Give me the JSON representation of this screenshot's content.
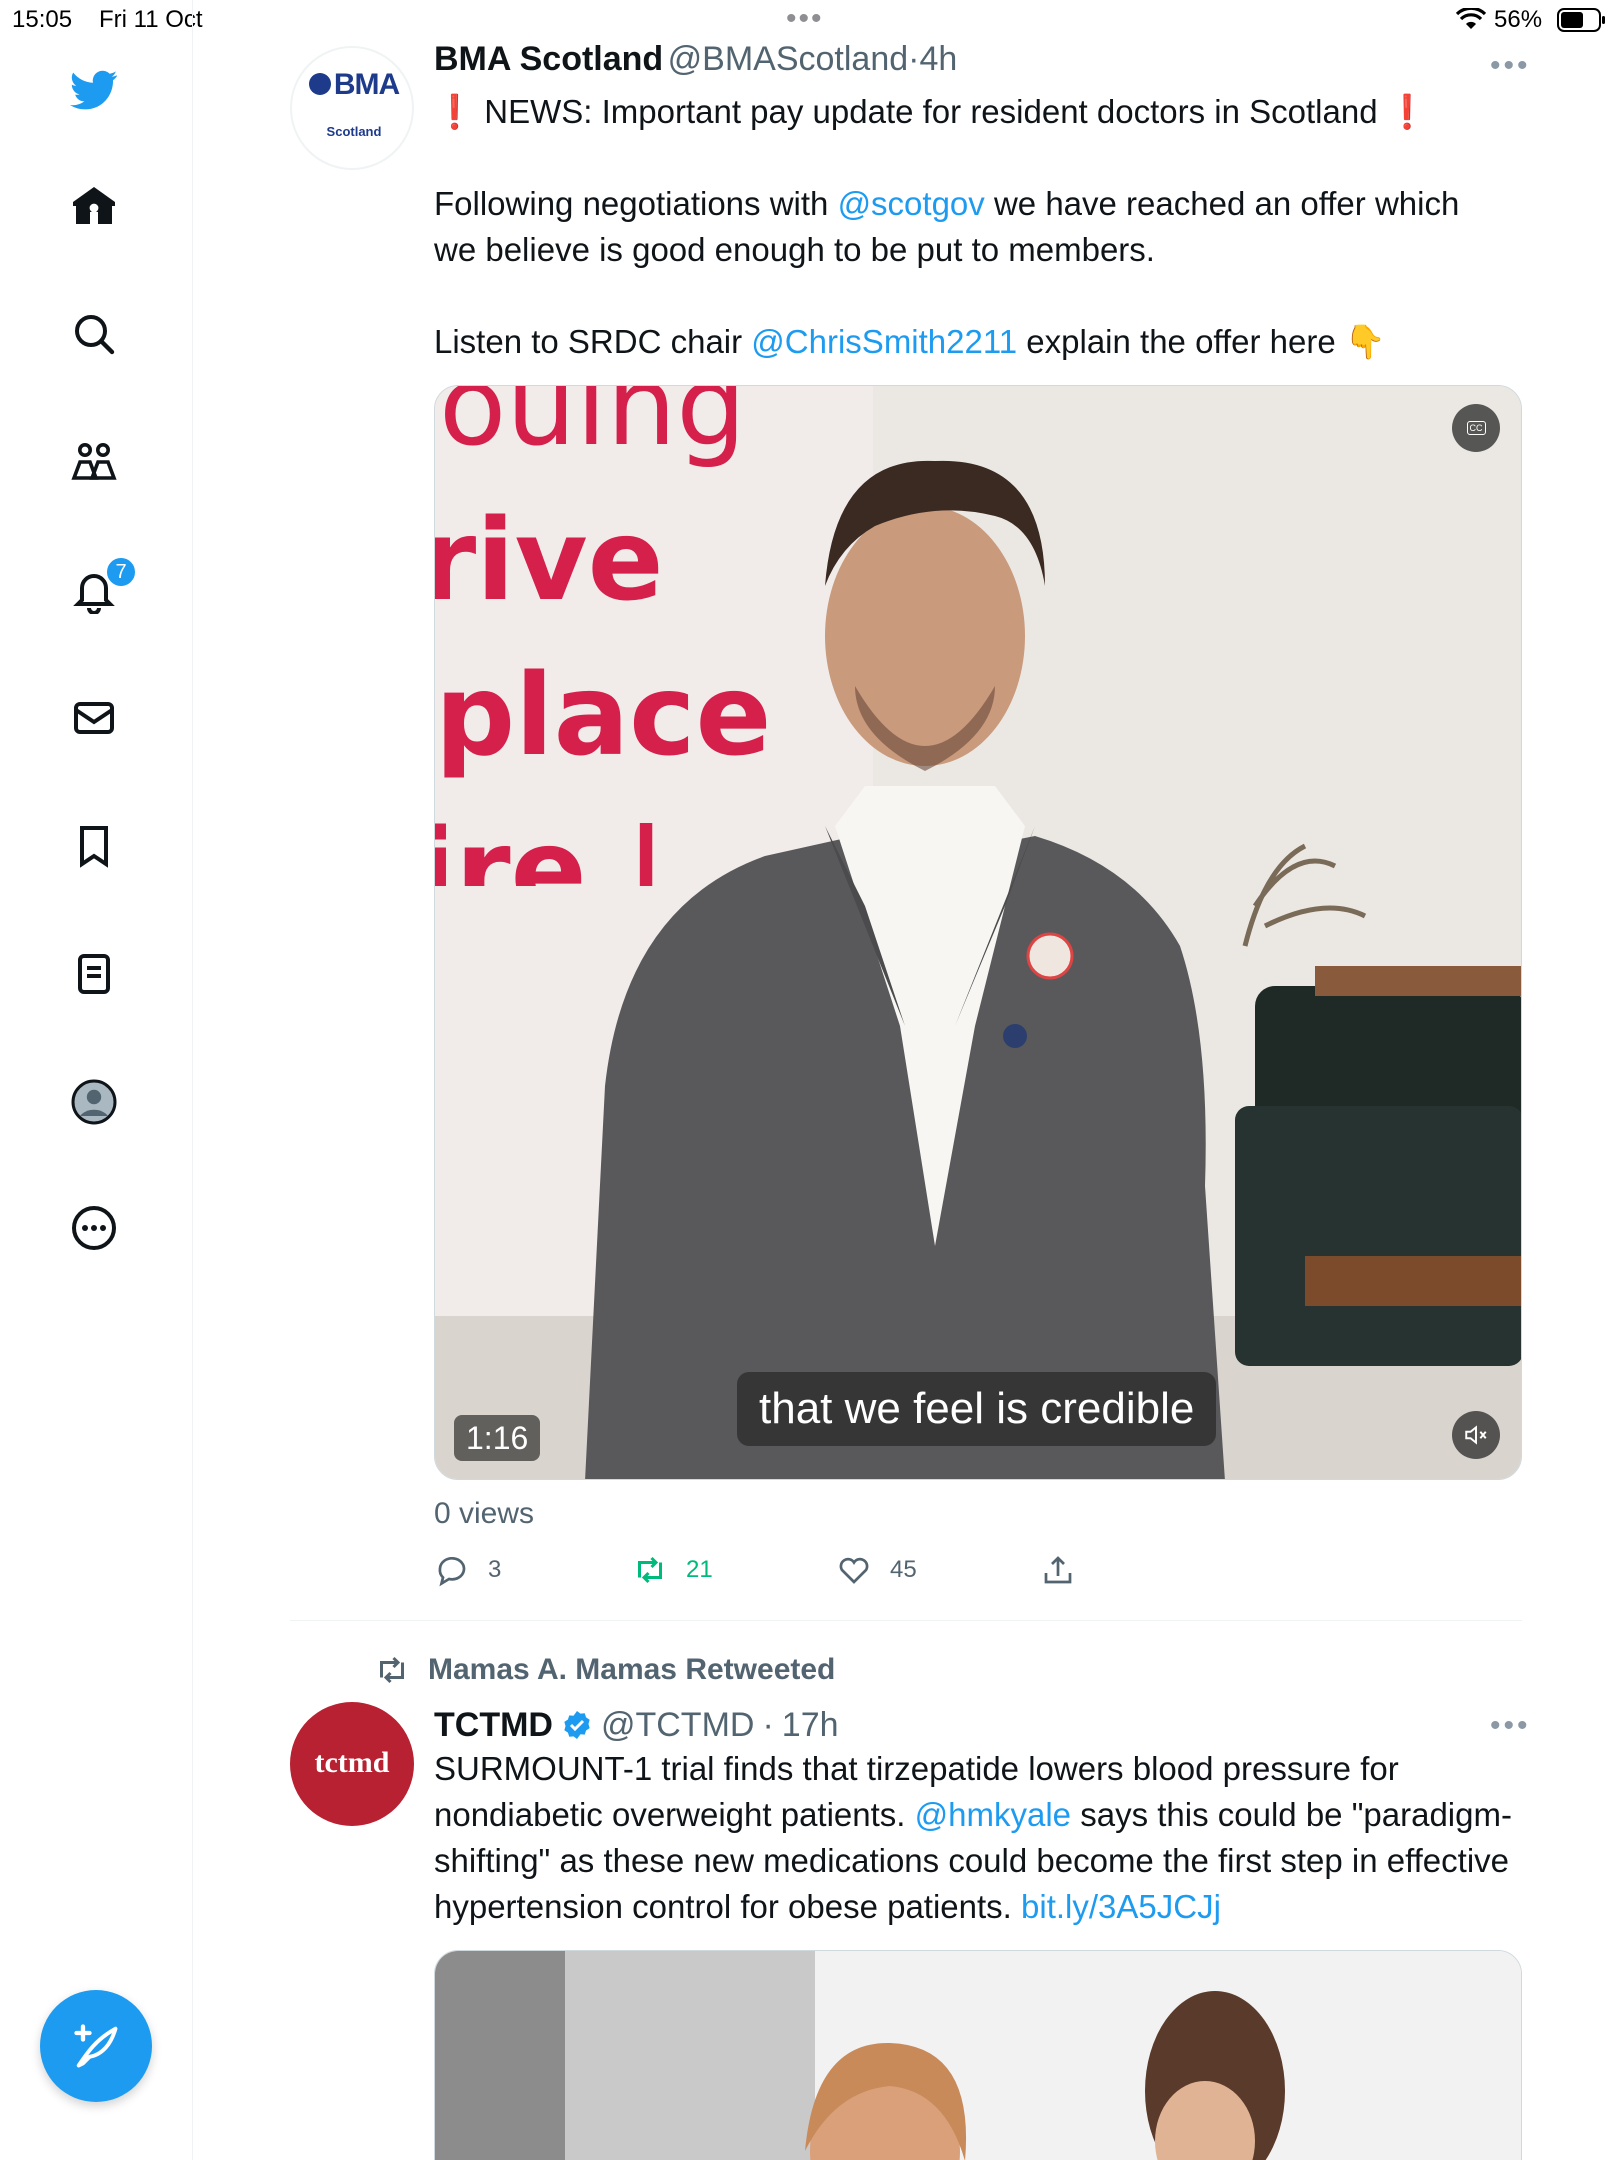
{
  "status_bar": {
    "time": "15:05",
    "date": "Fri 11 Oct",
    "dots": "•••",
    "battery_pct": "56%"
  },
  "sidebar": {
    "items": [
      {
        "name": "twitter-logo-icon"
      },
      {
        "name": "home-icon"
      },
      {
        "name": "search-icon"
      },
      {
        "name": "communities-icon"
      },
      {
        "name": "notifications-icon"
      },
      {
        "name": "messages-icon"
      },
      {
        "name": "bookmarks-icon"
      },
      {
        "name": "lists-icon"
      },
      {
        "name": "profile-icon"
      },
      {
        "name": "more-icon"
      }
    ],
    "notifications_badge": "7",
    "compose_icon": "compose-feather-icon"
  },
  "tweet1": {
    "avatar_logo": "BMA",
    "avatar_sub": "Scotland",
    "name": "BMA Scotland",
    "handle": "@BMAScotland",
    "sep": "·",
    "time": "4h",
    "more": "•••",
    "line1_emoji_left": "❗",
    "line1_text": "NEWS: Important pay update for resident doctors in Scotland",
    "line1_emoji_right": "❗",
    "para2_pre": "Following negotiations with ",
    "para2_mention": "@scotgov",
    "para2_post": " we have reached an offer which we believe is good enough to be put to members.",
    "para3_pre": "Listen to SRDC chair ",
    "para3_mention": "@ChrisSmith2211",
    "para3_post": " explain the offer here ",
    "para3_emoji": "👇",
    "video": {
      "banner_line1": "ouing",
      "banner_line2": "rive",
      "banner_line3": "place",
      "banner_line4": "ire |",
      "subtitle": "that we feel is credible",
      "duration": "1:16",
      "cc_label": "CC"
    },
    "views": "0 views",
    "replies": "3",
    "retweets": "21",
    "likes": "45",
    "colors": {
      "retweet_green": "#00ba7c",
      "link": "#1d9bf0",
      "subtle": "#536471"
    }
  },
  "tweet2": {
    "retweeted_by": "Mamas A. Mamas Retweeted",
    "avatar_text": "tctmd",
    "name": "TCTMD",
    "handle": "@TCTMD",
    "sep": "·",
    "time": "17h",
    "more": "•••",
    "text_pre": "SURMOUNT-1 trial finds that tirzepatide lowers blood pressure for nondiabetic overweight patients. ",
    "mention": "@hmkyale",
    "text_mid": " says this could be \"paradigm-shifting\" as these new medications could become the first step in effective hypertension control for obese patients. ",
    "link": "bit.ly/3A5JCJj",
    "avatar_color": "#b72132"
  }
}
